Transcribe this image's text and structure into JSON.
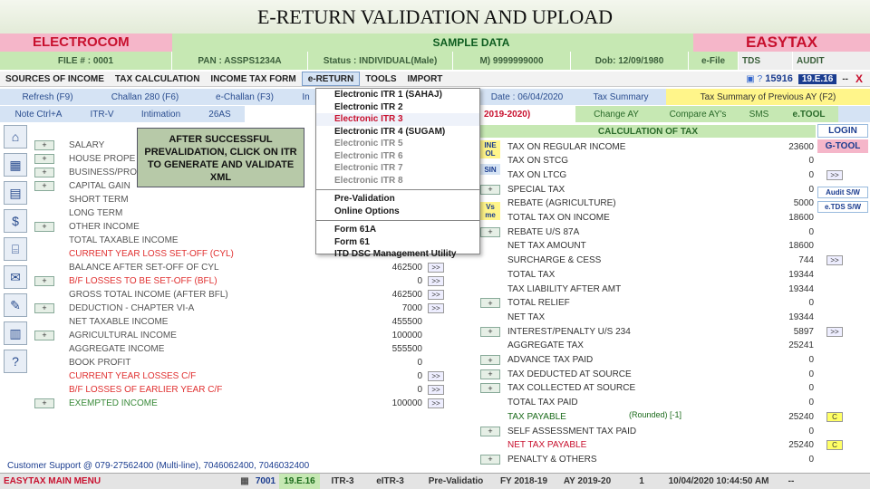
{
  "slide_title": "E-RETURN VALIDATION AND UPLOAD",
  "header": {
    "brand": "ELECTROCOM",
    "center": "SAMPLE DATA",
    "product": "EASYTAX"
  },
  "info": {
    "file": "FILE # : 0001",
    "pan": "PAN : ASSPS1234A",
    "status": "Status : INDIVIDUAL(Male)",
    "mobile": "M) 9999999000",
    "dob": "Dob: 12/09/1980",
    "efile": "e-File",
    "tds": "TDS",
    "audit": "AUDIT"
  },
  "menu": {
    "items": [
      "SOURCES OF INCOME",
      "TAX CALCULATION",
      "INCOME TAX FORM",
      "e-RETURN",
      "TOOLS",
      "IMPORT"
    ],
    "version": "15916",
    "version2": "19.E.16",
    "dash": "--",
    "close": "X"
  },
  "toolbar": {
    "refresh": "Refresh (F9)",
    "challan": "Challan 280 (F6)",
    "echallan": "e-Challan (F3)",
    "partial": "In",
    "date": "Date : 06/04/2020",
    "tax_summary": "Tax Summary",
    "tax_prev": "Tax Summary of Previous AY (F2)"
  },
  "toolbar2": {
    "note": "Note Ctrl+A",
    "itrv": "ITR-V",
    "intimation": "Intimation",
    "as26": "26AS",
    "ay": "2019-2020)",
    "change_ay": "Change AY",
    "compare": "Compare AY's",
    "sms": "SMS",
    "etool": "e.TOOL"
  },
  "right_side": {
    "calc_header": "CALCULATION OF TAX",
    "login": "LOGIN",
    "gtool": "G-TOOL",
    "audit_sw": "Audit S/W",
    "etds_sw": "e.TDS S/W",
    "line_tag": "INE",
    "line_tag2": "OL",
    "sin_tag": "SIN",
    "vs_tag": "Vs",
    "me_tag": "me"
  },
  "dropdown": [
    "Electronic ITR 1 (SAHAJ)",
    "Electronic ITR 2",
    "Electronic ITR 3",
    "Electronic ITR 4 (SUGAM)",
    "Electronic ITR 5",
    "Electronic ITR 6",
    "Electronic ITR 7",
    "Electronic ITR 8",
    "Pre-Validation",
    "Online Options",
    "Form 61A",
    "Form 61",
    "ITD DSC Management Utility"
  ],
  "callout": "AFTER SUCCESSFUL PREVALIDATION, CLICK ON ITR TO GENERATE AND VALIDATE XML",
  "left_rows": [
    {
      "label": "SALARY",
      "value": "",
      "btn": "+"
    },
    {
      "label": "HOUSE PROPE",
      "value": "",
      "btn": "+"
    },
    {
      "label": "BUSINESS/PRO",
      "value": "",
      "btn": "+"
    },
    {
      "label": "CAPITAL GAIN",
      "value": "",
      "btn": "+"
    },
    {
      "label": "SHORT TERM",
      "value": "0",
      "btn": ""
    },
    {
      "label": "LONG TERM",
      "value": "0",
      "btn": ""
    },
    {
      "label": "OTHER INCOME",
      "value": "",
      "btn": "+"
    },
    {
      "label": "TOTAL TAXABLE INCOME",
      "value": "",
      "btn": ""
    },
    {
      "label": "CURRENT YEAR LOSS SET-OFF (CYL)",
      "value": "",
      "btn": ""
    },
    {
      "label": "BALANCE AFTER SET-OFF OF CYL",
      "value": "462500",
      "btn": ""
    },
    {
      "label": "B/F LOSSES TO BE SET-OFF (BFL)",
      "value": "0",
      "btn": "+"
    },
    {
      "label": "GROSS TOTAL INCOME (AFTER BFL)",
      "value": "462500",
      "btn": ""
    },
    {
      "label": "DEDUCTION - CHAPTER VI-A",
      "value": "7000",
      "btn": "+"
    },
    {
      "label": "NET TAXABLE INCOME",
      "value": "455500",
      "btn": ""
    },
    {
      "label": "AGRICULTURAL INCOME",
      "value": "100000",
      "btn": "+"
    },
    {
      "label": "AGGREGATE INCOME",
      "value": "555500",
      "btn": ""
    },
    {
      "label": "BOOK PROFIT",
      "value": "0",
      "btn": ""
    },
    {
      "label": "CURRENT YEAR LOSSES C/F",
      "value": "0",
      "btn": ""
    },
    {
      "label": "B/F LOSSES OF EARLIER YEAR C/F",
      "value": "0",
      "btn": ""
    },
    {
      "label": "EXEMPTED INCOME",
      "value": "100000",
      "btn": "+"
    }
  ],
  "right_rows": [
    {
      "label": "TAX ON REGULAR INCOME",
      "value": "23600",
      "btn": ""
    },
    {
      "label": "TAX ON STCG",
      "value": "0",
      "btn": ""
    },
    {
      "label": "TAX ON LTCG",
      "value": "0",
      "btn": ""
    },
    {
      "label": "SPECIAL TAX",
      "value": "0",
      "btn": "+"
    },
    {
      "label": "REBATE (AGRICULTURE)",
      "value": "5000",
      "btn": ""
    },
    {
      "label": "TOTAL TAX ON INCOME",
      "value": "18600",
      "btn": ""
    },
    {
      "label": "REBATE U/S 87A",
      "value": "0",
      "btn": "+"
    },
    {
      "label": "NET TAX AMOUNT",
      "value": "18600",
      "btn": ""
    },
    {
      "label": "SURCHARGE & CESS",
      "value": "744",
      "btn": ""
    },
    {
      "label": "TOTAL TAX",
      "value": "19344",
      "btn": ""
    },
    {
      "label": "TAX LIABILITY AFTER AMT",
      "value": "19344",
      "btn": ""
    },
    {
      "label": "TOTAL RELIEF",
      "value": "0",
      "btn": "+"
    },
    {
      "label": "NET TAX",
      "value": "19344",
      "btn": ""
    },
    {
      "label": "INTEREST/PENALTY U/S 234",
      "value": "5897",
      "btn": "+"
    },
    {
      "label": "AGGREGATE TAX",
      "value": "25241",
      "btn": ""
    },
    {
      "label": "ADVANCE TAX PAID",
      "value": "0",
      "btn": "+"
    },
    {
      "label": "TAX DEDUCTED AT SOURCE",
      "value": "0",
      "btn": "+"
    },
    {
      "label": "TAX COLLECTED AT SOURCE",
      "value": "0",
      "btn": "+"
    },
    {
      "label": "TOTAL TAX PAID",
      "value": "0",
      "btn": ""
    },
    {
      "label": "TAX PAYABLE",
      "value": "25240",
      "btn": ""
    },
    {
      "label": "SELF ASSESSMENT TAX PAID",
      "value": "0",
      "btn": "+"
    },
    {
      "label": "NET TAX PAYABLE",
      "value": "25240",
      "btn": ""
    },
    {
      "label": "PENALTY & OTHERS",
      "value": "0",
      "btn": "+"
    }
  ],
  "rounded": "(Rounded) [-1]",
  "support": "Customer Support @ 079-27562400 (Multi-line), 7046062400, 7046032400",
  "statusbar": {
    "main_menu": "EASYTAX MAIN MENU",
    "code": "7001",
    "ver": "19.E.16",
    "itr": "ITR-3",
    "eitr": "eITR-3",
    "prevalid": "Pre-Validatio",
    "fy": "FY 2018-19",
    "ay": "AY 2019-20",
    "page": "1",
    "datetime": "10/04/2020 10:44:50 AM",
    "end": "--"
  },
  "colors": {
    "accent": "#c8102e",
    "green_bar": "#c6e8b3",
    "pink": "#f7c9d7",
    "yellow": "#fff58a",
    "blue": "#d5e3f4",
    "red_text": "#e03030"
  }
}
